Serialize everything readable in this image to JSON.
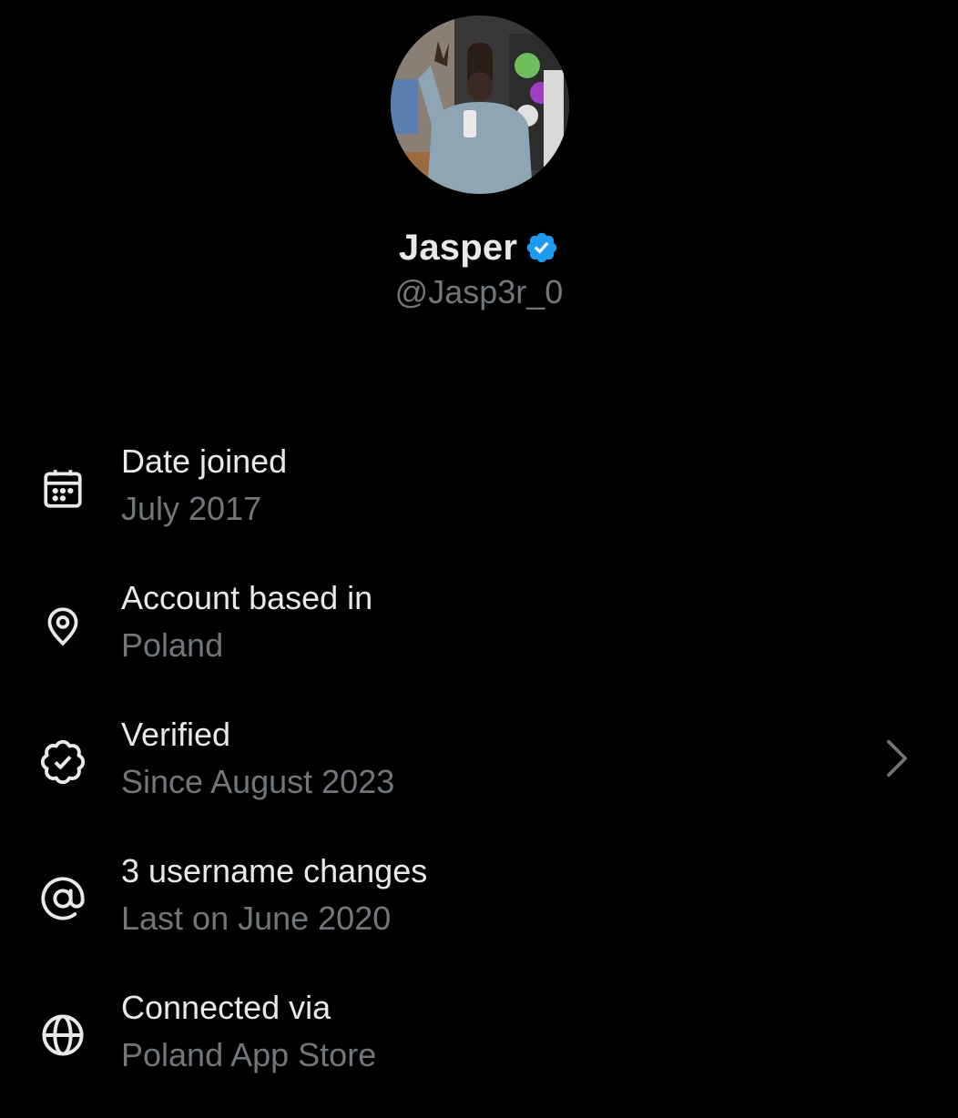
{
  "profile": {
    "display_name": "Jasper",
    "handle": "@Jasp3r_0",
    "avatar_icon": "profile-photo",
    "verified_icon": "verified-badge-icon"
  },
  "colors": {
    "background": "#000000",
    "primary_text": "#e7e9ea",
    "secondary_text": "#71767b",
    "verified_blue": "#1d9bf0"
  },
  "info": [
    {
      "icon": "calendar-icon",
      "title": "Date joined",
      "value": "July 2017"
    },
    {
      "icon": "location-pin-icon",
      "title": "Account based in",
      "value": "Poland"
    },
    {
      "icon": "verified-outline-icon",
      "title": "Verified",
      "value": "Since August 2023",
      "has_chevron": true
    },
    {
      "icon": "at-sign-icon",
      "title": "3 username changes",
      "value": "Last on June 2020"
    },
    {
      "icon": "globe-icon",
      "title": "Connected via",
      "value": "Poland App Store"
    }
  ]
}
